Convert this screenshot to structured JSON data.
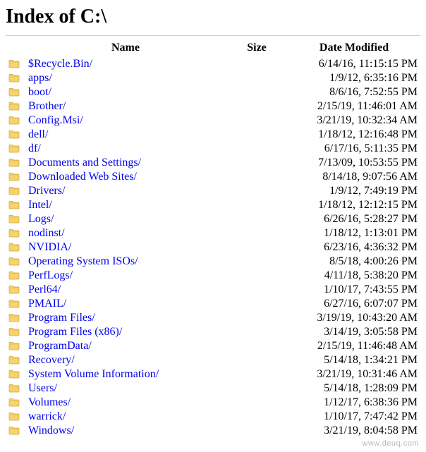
{
  "page": {
    "title_prefix": "Index of ",
    "path": "C:\\"
  },
  "columns": {
    "name": "Name",
    "size": "Size",
    "date": "Date Modified"
  },
  "entries": [
    {
      "name": "$Recycle.Bin/",
      "size": "",
      "date": "6/14/16, 11:15:15 PM",
      "type": "folder"
    },
    {
      "name": "apps/",
      "size": "",
      "date": "1/9/12, 6:35:16 PM",
      "type": "folder"
    },
    {
      "name": "boot/",
      "size": "",
      "date": "8/6/16, 7:52:55 PM",
      "type": "folder"
    },
    {
      "name": "Brother/",
      "size": "",
      "date": "2/15/19, 11:46:01 AM",
      "type": "folder"
    },
    {
      "name": "Config.Msi/",
      "size": "",
      "date": "3/21/19, 10:32:34 AM",
      "type": "folder"
    },
    {
      "name": "dell/",
      "size": "",
      "date": "1/18/12, 12:16:48 PM",
      "type": "folder"
    },
    {
      "name": "df/",
      "size": "",
      "date": "6/17/16, 5:11:35 PM",
      "type": "folder"
    },
    {
      "name": "Documents and Settings/",
      "size": "",
      "date": "7/13/09, 10:53:55 PM",
      "type": "folder"
    },
    {
      "name": "Downloaded Web Sites/",
      "size": "",
      "date": "8/14/18, 9:07:56 AM",
      "type": "folder"
    },
    {
      "name": "Drivers/",
      "size": "",
      "date": "1/9/12, 7:49:19 PM",
      "type": "folder"
    },
    {
      "name": "Intel/",
      "size": "",
      "date": "1/18/12, 12:12:15 PM",
      "type": "folder"
    },
    {
      "name": "Logs/",
      "size": "",
      "date": "6/26/16, 5:28:27 PM",
      "type": "folder"
    },
    {
      "name": "nodinst/",
      "size": "",
      "date": "1/18/12, 1:13:01 PM",
      "type": "folder"
    },
    {
      "name": "NVIDIA/",
      "size": "",
      "date": "6/23/16, 4:36:32 PM",
      "type": "folder"
    },
    {
      "name": "Operating System ISOs/",
      "size": "",
      "date": "8/5/18, 4:00:26 PM",
      "type": "folder"
    },
    {
      "name": "PerfLogs/",
      "size": "",
      "date": "4/11/18, 5:38:20 PM",
      "type": "folder"
    },
    {
      "name": "Perl64/",
      "size": "",
      "date": "1/10/17, 7:43:55 PM",
      "type": "folder"
    },
    {
      "name": "PMAIL/",
      "size": "",
      "date": "6/27/16, 6:07:07 PM",
      "type": "folder"
    },
    {
      "name": "Program Files/",
      "size": "",
      "date": "3/19/19, 10:43:20 AM",
      "type": "folder"
    },
    {
      "name": "Program Files (x86)/",
      "size": "",
      "date": "3/14/19, 3:05:58 PM",
      "type": "folder"
    },
    {
      "name": "ProgramData/",
      "size": "",
      "date": "2/15/19, 11:46:48 AM",
      "type": "folder"
    },
    {
      "name": "Recovery/",
      "size": "",
      "date": "5/14/18, 1:34:21 PM",
      "type": "folder"
    },
    {
      "name": "System Volume Information/",
      "size": "",
      "date": "3/21/19, 10:31:46 AM",
      "type": "folder"
    },
    {
      "name": "Users/",
      "size": "",
      "date": "5/14/18, 1:28:09 PM",
      "type": "folder"
    },
    {
      "name": "Volumes/",
      "size": "",
      "date": "1/12/17, 6:38:36 PM",
      "type": "folder"
    },
    {
      "name": "warrick/",
      "size": "",
      "date": "1/10/17, 7:47:42 PM",
      "type": "folder"
    },
    {
      "name": "Windows/",
      "size": "",
      "date": "3/21/19, 8:04:58 PM",
      "type": "folder"
    }
  ],
  "watermark": "www.deuq.com"
}
